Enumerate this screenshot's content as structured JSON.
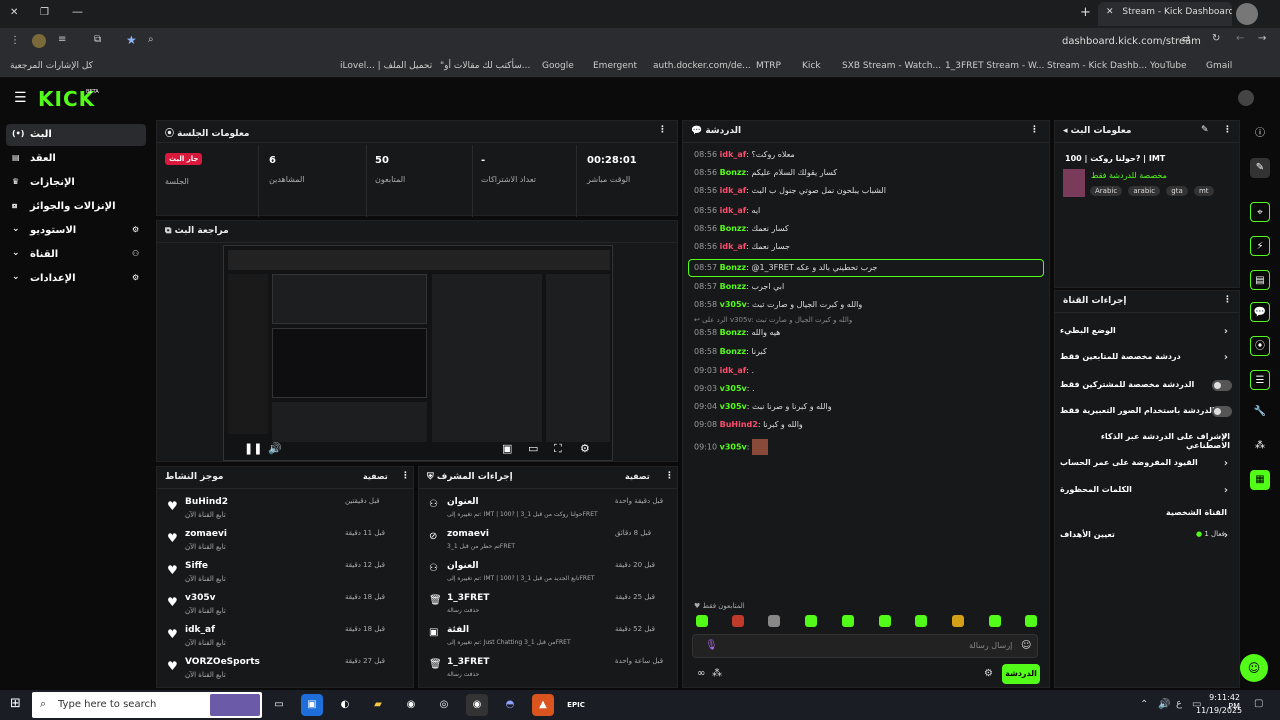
{
  "browser": {
    "tab_title": "Stream - Kick Dashboard",
    "url": "dashboard.kick.com/stream",
    "bookmarks": [
      "كل الإشارات المرجعية",
      "iLovel... | تحميل الملف",
      "\"سأكتب لك مقالات أو...",
      "Google",
      "Emergent",
      "auth.docker.com/de...",
      "MTRP",
      "Kick",
      "SXB Stream - Watch...",
      "1_3FRET Stream - W...",
      "Stream - Kick Dashb...",
      "YouTube",
      "Gmail"
    ]
  },
  "brand": {
    "logo": "KICK",
    "badge": "BETA"
  },
  "sidebar": {
    "items": [
      {
        "label": "البث",
        "icon": "live-icon"
      },
      {
        "label": "العقد",
        "icon": "contract-icon"
      },
      {
        "label": "الإنجازات",
        "icon": "trophy-icon"
      },
      {
        "label": "الإنزالات والجوائز",
        "icon": "drops-icon"
      },
      {
        "label": "الاستوديو",
        "icon": "studio-icon"
      },
      {
        "label": "القناة",
        "icon": "channel-icon"
      },
      {
        "label": "الإعدادات",
        "icon": "settings-icon"
      }
    ]
  },
  "session": {
    "title": "معلومات الجلسة",
    "live_label": "جار البث",
    "session_label": "الجلسة",
    "stats": [
      {
        "value": "6",
        "label": "المشاهدين"
      },
      {
        "value": "50",
        "label": "المتابعون"
      },
      {
        "value": "-",
        "label": "تعداد الاشتراكات"
      },
      {
        "value": "00:28:01",
        "label": "الوقت مباشر"
      }
    ]
  },
  "preview": {
    "title": "مراجعة البث"
  },
  "activity": {
    "title": "موجز النشاط",
    "filter": "تصفية",
    "items": [
      {
        "name": "BuHind2",
        "sub": "تابع القناة الآن",
        "time": "قبل دقيقتين"
      },
      {
        "name": "zomaevi",
        "sub": "تابع القناة الآن",
        "time": "قبل 11 دقيقة"
      },
      {
        "name": "Siffe",
        "sub": "تابع القناة الآن",
        "time": "قبل 12 دقيقة"
      },
      {
        "name": "v305v",
        "sub": "تابع القناة الآن",
        "time": "قبل 18 دقيقة"
      },
      {
        "name": "idk_af",
        "sub": "تابع القناة الآن",
        "time": "قبل 18 دقيقة"
      },
      {
        "name": "VORZOeSports",
        "sub": "تابع القناة الآن",
        "time": "قبل 27 دقيقة"
      }
    ]
  },
  "modactions": {
    "title": "إجراءات المشرف",
    "filter": "تصفية",
    "items": [
      {
        "name": "العنوان",
        "sub": "تم تغييره إلى: IMT | 100? | حولنا روكت من قبل 1_3FRET",
        "time": "قبل دقيقة واحدة"
      },
      {
        "name": "zomaevi",
        "sub": "تم حظر من قبل 1_3FRET",
        "time": "قبل 8 دقائق"
      },
      {
        "name": "العنوان",
        "sub": "تم تغييره إلى: IMT | 100? | تابع الجديد من قبل 1_3FRET",
        "time": "قبل 20 دقيقة"
      },
      {
        "name": "1_3FRET",
        "sub": "حذفت رسالة",
        "time": "قبل 25 دقيقة"
      },
      {
        "name": "الفئة",
        "sub": "تم تغييره إلى: Just Chatting من قبل 1_3FRET",
        "time": "قبل 52 دقيقة"
      },
      {
        "name": "1_3FRET",
        "sub": "حذفت رسالة",
        "time": "قبل ساعة واحدة"
      }
    ]
  },
  "chat": {
    "title": "الدردشة",
    "lines": [
      {
        "time": "08:56",
        "user": "idk_af",
        "color": "red",
        "text": "معلاه روكت؟"
      },
      {
        "time": "08:56",
        "user": "Bonzz",
        "color": "green",
        "text": "كسار يقولك السلام عليكم"
      },
      {
        "time": "08:56",
        "user": "idk_af",
        "color": "red",
        "text": "الشباب يبلحون نمل صوتي جنول ب البث"
      },
      {
        "time": "08:56",
        "user": "idk_af",
        "color": "red",
        "text": "ايه"
      },
      {
        "time": "08:56",
        "user": "Bonzz",
        "color": "green",
        "text": "كسار نعمك"
      },
      {
        "time": "08:56",
        "user": "idk_af",
        "color": "red",
        "text": "جسار نعمك"
      },
      {
        "time": "08:57",
        "user": "Bonzz",
        "color": "green",
        "text": "@1_3FRET جرب تحطيني بالد و عكه"
      },
      {
        "time": "08:57",
        "user": "Bonzz",
        "color": "green",
        "text": "ابي اجرب"
      },
      {
        "time": "08:58",
        "user": "v305v",
        "color": "green",
        "text": "والله و كبرت الجيال و صارت تبث"
      },
      {
        "time": "08:58",
        "user": "Bonzz",
        "color": "green",
        "text": "هيه والله"
      },
      {
        "time": "08:58",
        "user": "Bonzz",
        "color": "green",
        "text": "كبرنا"
      },
      {
        "time": "09:03",
        "user": "idk_af",
        "color": "red",
        "text": "."
      },
      {
        "time": "09:03",
        "user": "v305v",
        "color": "green",
        "text": "."
      },
      {
        "time": "09:04",
        "user": "v305v",
        "color": "green",
        "text": "والله و كبرنا و صرنا نبث"
      },
      {
        "time": "09:08",
        "user": "BuHind2",
        "color": "red",
        "text": "والله و كبرنا"
      },
      {
        "time": "09:10",
        "user": "v305v",
        "color": "green",
        "text": ""
      }
    ],
    "reply_hint": "الرد على v305v: والله و كبرت الجيال و صارت تبث",
    "followers_only": "المتابعون فقط",
    "input_placeholder": "إرسال رسالة",
    "send_label": "الدردشة"
  },
  "streaminfo": {
    "title": "معلومات البث",
    "stream_title": "حولنا روكت | 100? | IMT",
    "category": "مخصصة للدردشة فقط",
    "tags": [
      "Arabic",
      "arabic",
      "gta",
      "mt"
    ]
  },
  "channelactions": {
    "title": "إجراءات القناة",
    "rows": [
      {
        "label": "الوضع البطيء",
        "type": "chevron"
      },
      {
        "label": "دردشة مخصصة للمتابعين فقط",
        "type": "chevron"
      },
      {
        "label": "الدردشة مخصصة للمشتركين فقط",
        "type": "toggle"
      },
      {
        "label": "الدردشة باستخدام الصور التعبيرية فقط",
        "type": "toggle"
      },
      {
        "label": "الإشراف على الدردشة عبر الذكاء الاصطناعي",
        "type": "external"
      },
      {
        "label": "القيود المفروضة على عمر الحساب",
        "type": "chevron"
      },
      {
        "label": "الكلمات المحظورة",
        "type": "chevron"
      }
    ],
    "personal_heading": "القناة الشخصية",
    "goals_label": "تعيين الأهداف",
    "goals_status": "فعال 1"
  },
  "taskbar": {
    "search_placeholder": "Type here to search",
    "time": "9:11:42 PM",
    "date": "11/19/2025",
    "lang": "ع"
  }
}
